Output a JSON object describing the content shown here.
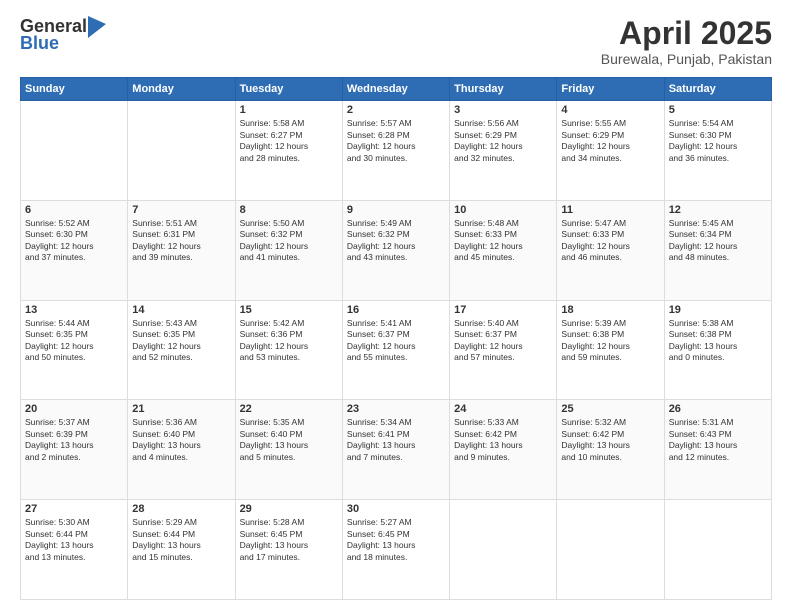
{
  "header": {
    "logo_general": "General",
    "logo_blue": "Blue",
    "month_title": "April 2025",
    "subtitle": "Burewala, Punjab, Pakistan"
  },
  "days_of_week": [
    "Sunday",
    "Monday",
    "Tuesday",
    "Wednesday",
    "Thursday",
    "Friday",
    "Saturday"
  ],
  "weeks": [
    [
      {
        "day": "",
        "info": ""
      },
      {
        "day": "",
        "info": ""
      },
      {
        "day": "1",
        "info": "Sunrise: 5:58 AM\nSunset: 6:27 PM\nDaylight: 12 hours\nand 28 minutes."
      },
      {
        "day": "2",
        "info": "Sunrise: 5:57 AM\nSunset: 6:28 PM\nDaylight: 12 hours\nand 30 minutes."
      },
      {
        "day": "3",
        "info": "Sunrise: 5:56 AM\nSunset: 6:29 PM\nDaylight: 12 hours\nand 32 minutes."
      },
      {
        "day": "4",
        "info": "Sunrise: 5:55 AM\nSunset: 6:29 PM\nDaylight: 12 hours\nand 34 minutes."
      },
      {
        "day": "5",
        "info": "Sunrise: 5:54 AM\nSunset: 6:30 PM\nDaylight: 12 hours\nand 36 minutes."
      }
    ],
    [
      {
        "day": "6",
        "info": "Sunrise: 5:52 AM\nSunset: 6:30 PM\nDaylight: 12 hours\nand 37 minutes."
      },
      {
        "day": "7",
        "info": "Sunrise: 5:51 AM\nSunset: 6:31 PM\nDaylight: 12 hours\nand 39 minutes."
      },
      {
        "day": "8",
        "info": "Sunrise: 5:50 AM\nSunset: 6:32 PM\nDaylight: 12 hours\nand 41 minutes."
      },
      {
        "day": "9",
        "info": "Sunrise: 5:49 AM\nSunset: 6:32 PM\nDaylight: 12 hours\nand 43 minutes."
      },
      {
        "day": "10",
        "info": "Sunrise: 5:48 AM\nSunset: 6:33 PM\nDaylight: 12 hours\nand 45 minutes."
      },
      {
        "day": "11",
        "info": "Sunrise: 5:47 AM\nSunset: 6:33 PM\nDaylight: 12 hours\nand 46 minutes."
      },
      {
        "day": "12",
        "info": "Sunrise: 5:45 AM\nSunset: 6:34 PM\nDaylight: 12 hours\nand 48 minutes."
      }
    ],
    [
      {
        "day": "13",
        "info": "Sunrise: 5:44 AM\nSunset: 6:35 PM\nDaylight: 12 hours\nand 50 minutes."
      },
      {
        "day": "14",
        "info": "Sunrise: 5:43 AM\nSunset: 6:35 PM\nDaylight: 12 hours\nand 52 minutes."
      },
      {
        "day": "15",
        "info": "Sunrise: 5:42 AM\nSunset: 6:36 PM\nDaylight: 12 hours\nand 53 minutes."
      },
      {
        "day": "16",
        "info": "Sunrise: 5:41 AM\nSunset: 6:37 PM\nDaylight: 12 hours\nand 55 minutes."
      },
      {
        "day": "17",
        "info": "Sunrise: 5:40 AM\nSunset: 6:37 PM\nDaylight: 12 hours\nand 57 minutes."
      },
      {
        "day": "18",
        "info": "Sunrise: 5:39 AM\nSunset: 6:38 PM\nDaylight: 12 hours\nand 59 minutes."
      },
      {
        "day": "19",
        "info": "Sunrise: 5:38 AM\nSunset: 6:38 PM\nDaylight: 13 hours\nand 0 minutes."
      }
    ],
    [
      {
        "day": "20",
        "info": "Sunrise: 5:37 AM\nSunset: 6:39 PM\nDaylight: 13 hours\nand 2 minutes."
      },
      {
        "day": "21",
        "info": "Sunrise: 5:36 AM\nSunset: 6:40 PM\nDaylight: 13 hours\nand 4 minutes."
      },
      {
        "day": "22",
        "info": "Sunrise: 5:35 AM\nSunset: 6:40 PM\nDaylight: 13 hours\nand 5 minutes."
      },
      {
        "day": "23",
        "info": "Sunrise: 5:34 AM\nSunset: 6:41 PM\nDaylight: 13 hours\nand 7 minutes."
      },
      {
        "day": "24",
        "info": "Sunrise: 5:33 AM\nSunset: 6:42 PM\nDaylight: 13 hours\nand 9 minutes."
      },
      {
        "day": "25",
        "info": "Sunrise: 5:32 AM\nSunset: 6:42 PM\nDaylight: 13 hours\nand 10 minutes."
      },
      {
        "day": "26",
        "info": "Sunrise: 5:31 AM\nSunset: 6:43 PM\nDaylight: 13 hours\nand 12 minutes."
      }
    ],
    [
      {
        "day": "27",
        "info": "Sunrise: 5:30 AM\nSunset: 6:44 PM\nDaylight: 13 hours\nand 13 minutes."
      },
      {
        "day": "28",
        "info": "Sunrise: 5:29 AM\nSunset: 6:44 PM\nDaylight: 13 hours\nand 15 minutes."
      },
      {
        "day": "29",
        "info": "Sunrise: 5:28 AM\nSunset: 6:45 PM\nDaylight: 13 hours\nand 17 minutes."
      },
      {
        "day": "30",
        "info": "Sunrise: 5:27 AM\nSunset: 6:45 PM\nDaylight: 13 hours\nand 18 minutes."
      },
      {
        "day": "",
        "info": ""
      },
      {
        "day": "",
        "info": ""
      },
      {
        "day": "",
        "info": ""
      }
    ]
  ]
}
